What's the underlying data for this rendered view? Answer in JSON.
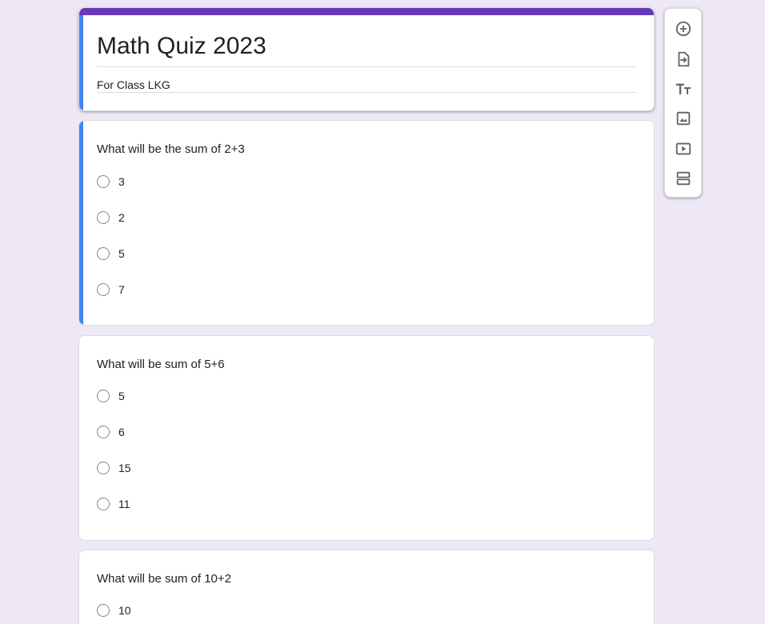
{
  "form": {
    "title": "Math Quiz 2023",
    "description": "For Class LKG",
    "theme_color": "#673ab7",
    "focus_color": "#4285f4",
    "background_color": "#ede7f6"
  },
  "questions": [
    {
      "title": "What will be the sum of 2+3",
      "options": [
        "3",
        "2",
        "5",
        "7"
      ]
    },
    {
      "title": "What will be sum of 5+6",
      "options": [
        "5",
        "6",
        "15",
        "11"
      ]
    },
    {
      "title": "What will be sum of 10+2",
      "options": [
        "10"
      ]
    }
  ],
  "toolbar": {
    "items": [
      {
        "icon": "add-question-icon"
      },
      {
        "icon": "import-questions-icon"
      },
      {
        "icon": "add-title-description-icon"
      },
      {
        "icon": "add-image-icon"
      },
      {
        "icon": "add-video-icon"
      },
      {
        "icon": "add-section-icon"
      }
    ]
  }
}
